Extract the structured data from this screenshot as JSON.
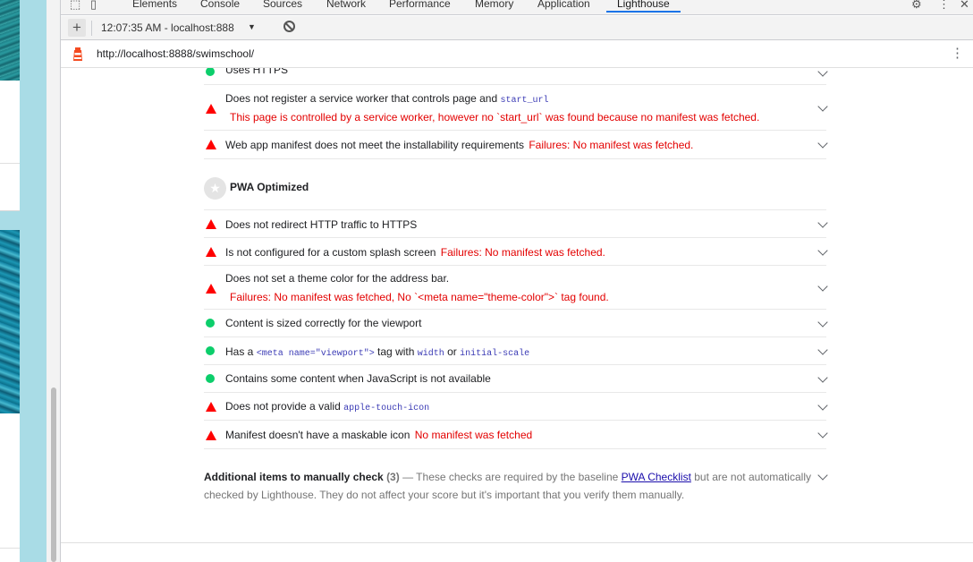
{
  "devtools": {
    "tabs": [
      "Elements",
      "Console",
      "Sources",
      "Network",
      "Performance",
      "Memory",
      "Application",
      "Lighthouse"
    ],
    "active_tab": "Lighthouse",
    "report_select": "12:07:35 AM - localhost:888",
    "url": "http://localhost:8888/swimschool/"
  },
  "audits_installable": [
    {
      "status": "pass",
      "title": "Uses HTTPS",
      "chevron": "chevron-down"
    },
    {
      "status": "fail",
      "title": "Does not register a service worker that controls page and ",
      "code": "start_url",
      "sub": "This page is controlled by a service worker, however no `start_url` was found because no manifest was fetched."
    },
    {
      "status": "fail",
      "title": "Web app manifest does not meet the installability requirements",
      "display": "Failures: No manifest was fetched."
    }
  ],
  "group": {
    "title": "PWA Optimized",
    "icon": "star-icon"
  },
  "audits_optimized": [
    {
      "status": "fail",
      "title": "Does not redirect HTTP traffic to HTTPS"
    },
    {
      "status": "fail",
      "title": "Is not configured for a custom splash screen",
      "display": "Failures: No manifest was fetched."
    },
    {
      "status": "fail",
      "title": "Does not set a theme color for the address bar.",
      "sub": "Failures: No manifest was fetched, No `<meta name=\"theme-color\">` tag found."
    },
    {
      "status": "pass",
      "title": "Content is sized correctly for the viewport"
    },
    {
      "status": "pass",
      "title_a": "Has a ",
      "code_a": "<meta name=\"viewport\">",
      "title_b": " tag with ",
      "code_b": "width",
      "title_c": " or ",
      "code_c": "initial-scale"
    },
    {
      "status": "pass",
      "title": "Contains some content when JavaScript is not available"
    },
    {
      "status": "fail",
      "title": "Does not provide a valid ",
      "code": "apple-touch-icon"
    },
    {
      "status": "fail",
      "title": "Manifest doesn't have a maskable icon",
      "display": "No manifest was fetched"
    }
  ],
  "manual": {
    "title": "Additional items to manually check",
    "count": "(3)",
    "dash": " — These checks are required by the baseline ",
    "link": "PWA Checklist",
    "rest": " but are not automatically checked by Lighthouse. They do not affect your score but it's important that you verify them manually."
  },
  "colors": {
    "pass": "#0cce6b",
    "fail": "#ff0000",
    "fail_text": "#e30000",
    "accent": "#1a73e8"
  }
}
